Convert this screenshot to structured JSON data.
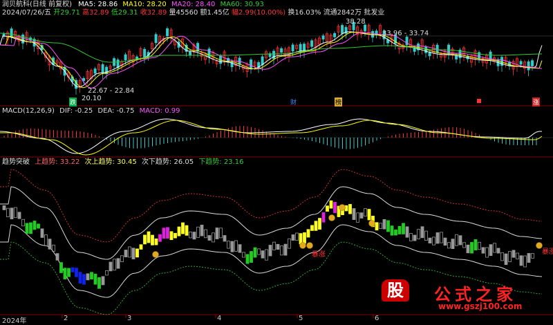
{
  "stock": {
    "name": "润贝航科(日线 前复权)",
    "ma5_label": "MA5: 28.86",
    "ma10_label": "MA10: 28.20",
    "ma20_label": "MA20: 28.40",
    "ma60_label": "MA60: 30.93"
  },
  "quote": {
    "date": "2024/07/26/五",
    "open": "开29.71",
    "high": "高32.89",
    "low": "低29.31",
    "close": "收32.89",
    "volume": "量45560",
    "amount": "额1.45亿",
    "change": "幅2.99(10.00%)",
    "turnover": "换16.03%",
    "float": "流通2842万",
    "industry": "批发业"
  },
  "price_annotations": {
    "peak": "38.28",
    "range_right": "33.96 - 33.74",
    "range_low": "22.67 - 22.84",
    "low": "20.10"
  },
  "event_marks": [
    "跌",
    "财",
    "榜",
    "",
    "涨"
  ],
  "macd": {
    "title": "MACD(12,26,9)",
    "dif": "DIF: -0.25",
    "dea": "DEA: -0.75",
    "macd": "MACD: 0.99"
  },
  "trend": {
    "title": "趋势突破",
    "up": "上趋势: 33.22",
    "sub_up": "次上趋势: 30.45",
    "sub_down": "次下趋势: 26.05",
    "down": "下趋势: 23.16",
    "tag_left": "暴涨",
    "tag_right": "暴涨"
  },
  "x_axis": [
    "2024年",
    "2",
    "3",
    "4",
    "5",
    "6"
  ],
  "watermark": {
    "logo_char": "股",
    "text": "公式之家",
    "url": "www.gszj100.com"
  },
  "colors": {
    "up": "#ff3333",
    "down": "#33cccc",
    "ma5": "#ffffff",
    "ma10": "#ffff00",
    "ma20": "#ff55ff",
    "ma60": "#33cc33",
    "bg": "#000000"
  }
}
